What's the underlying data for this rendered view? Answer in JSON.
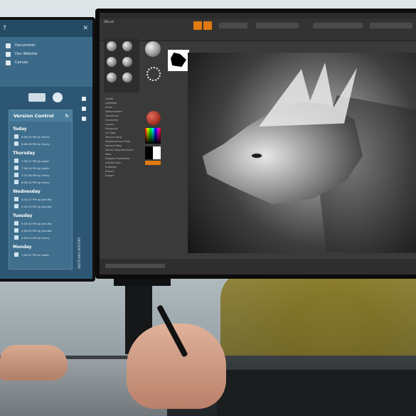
{
  "left_monitor": {
    "version_control": {
      "title": "Version Control",
      "days": [
        {
          "label": "Today",
          "entries": [
            "8:08:25 PM by Henry",
            "8:08:16 PM by Henry"
          ]
        },
        {
          "label": "Thursday",
          "entries": [
            "7:36:27 PM by Justin",
            "7:36:18 PM by Justin",
            "7:31:48 PM by Henry",
            "6:58:14 PM by Henry"
          ]
        },
        {
          "label": "Wednesday",
          "entries": [
            "5:44:27 PM by Jennifer",
            "5:41:53 PM by Jennifer"
          ]
        },
        {
          "label": "Tuesday",
          "entries": [
            "5:05:42 PM by Jennifer",
            "4:55:53 PM by Jennifer",
            "4:55:10 PM by Henry"
          ]
        },
        {
          "label": "Monday",
          "entries": [
            "1:59:37 PM by Justin"
          ]
        }
      ]
    },
    "file_rows": [
      "Documents",
      "Dev Website",
      "Canvas"
    ],
    "side_tab": "SKETCHES HISTORY"
  },
  "right_monitor": {
    "app_title": "ZBrush",
    "tool_list": [
      "Lights",
      "Lightbox",
      "Draw",
      "Deformation",
      "Transform",
      "Geometry",
      "Layers",
      "Polypaint",
      "UV Map",
      "Texture Map",
      "Displacement Map",
      "Normal Map",
      "Vector Displacement Map",
      "Display Properties",
      "Unified Skin",
      "Initialize",
      "Import",
      "Export"
    ],
    "colors": {
      "accent": "#e07a10",
      "bg": "#3a3a3a"
    }
  }
}
